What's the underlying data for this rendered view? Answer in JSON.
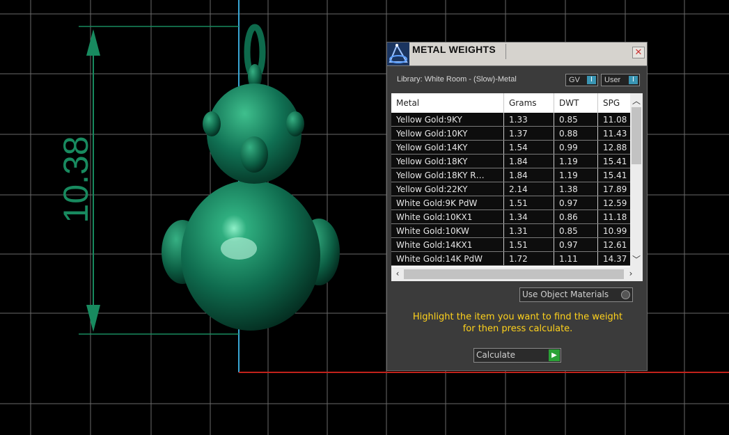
{
  "viewport": {
    "dimension_value": "10.38",
    "model_color": "#0f6b4e",
    "grid_color": "#6a6a6a",
    "dimension_color": "#188a5f",
    "axis_x_color": "#c2221b",
    "axis_y_color": "#3aa7d4"
  },
  "dialog": {
    "title": "METAL WEIGHTS",
    "close_glyph": "✕",
    "library_label": "Library: White Room - (Slow)-Metal",
    "gv_label": "GV",
    "user_label": "User",
    "toggle_glyph": "I",
    "table": {
      "headers": [
        "Metal",
        "Grams",
        "DWT",
        "SPG"
      ],
      "rows": [
        [
          "Yellow Gold:9KY",
          "1.33",
          "0.85",
          "11.08"
        ],
        [
          "Yellow Gold:10KY",
          "1.37",
          "0.88",
          "11.43"
        ],
        [
          "Yellow Gold:14KY",
          "1.54",
          "0.99",
          "12.88"
        ],
        [
          "Yellow Gold:18KY",
          "1.84",
          "1.19",
          "15.41"
        ],
        [
          "Yellow Gold:18KY R…",
          "1.84",
          "1.19",
          "15.41"
        ],
        [
          "Yellow Gold:22KY",
          "2.14",
          "1.38",
          "17.89"
        ],
        [
          "White Gold:9K PdW",
          "1.51",
          "0.97",
          "12.59"
        ],
        [
          "White Gold:10KX1",
          "1.34",
          "0.86",
          "11.18"
        ],
        [
          "White Gold:10KW",
          "1.31",
          "0.85",
          "10.99"
        ],
        [
          "White Gold:14KX1",
          "1.51",
          "0.97",
          "12.61"
        ],
        [
          "White Gold:14K PdW",
          "1.72",
          "1.11",
          "14.37"
        ]
      ]
    },
    "use_materials_label": "Use Object Materials",
    "hint_line1": "Highlight the item you want to find the weight",
    "hint_line2": "for then press calculate.",
    "calculate_label": "Calculate",
    "calculate_glyph": "▶"
  }
}
